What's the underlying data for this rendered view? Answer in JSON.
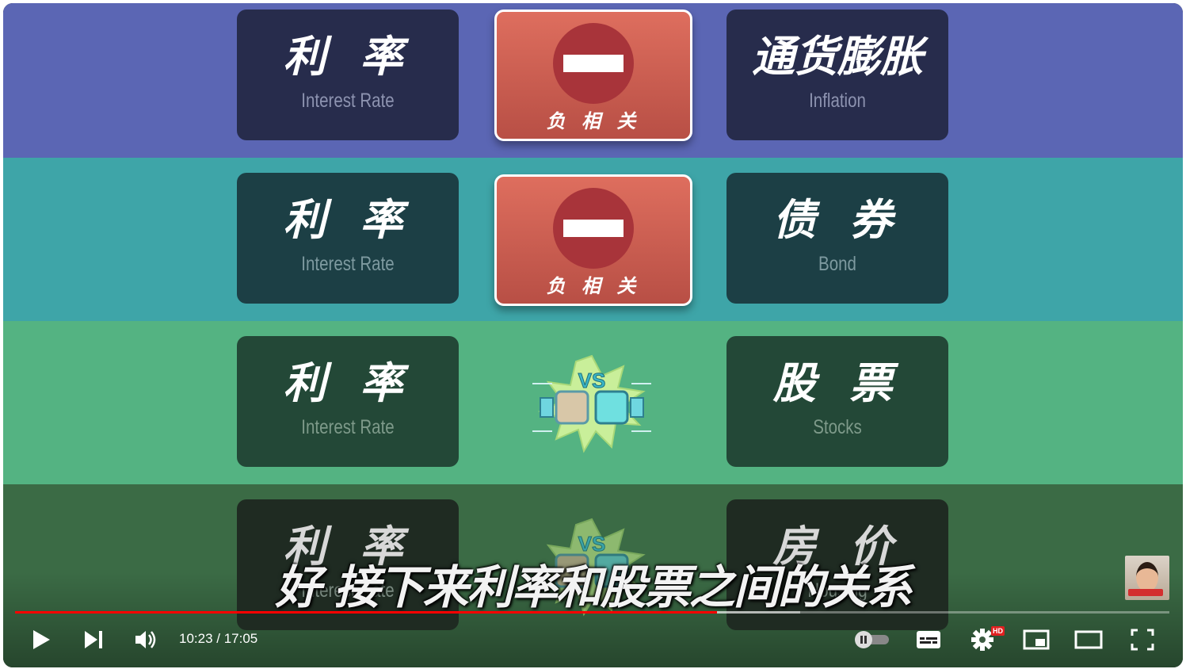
{
  "rows": [
    {
      "left": {
        "zh": "利 率",
        "en": "Interest Rate"
      },
      "middle": {
        "kind": "negative",
        "label": "负 相 关"
      },
      "right": {
        "zh": "通货膨胀",
        "en": "Inflation"
      }
    },
    {
      "left": {
        "zh": "利 率",
        "en": "Interest Rate"
      },
      "middle": {
        "kind": "negative",
        "label": "负 相 关"
      },
      "right": {
        "zh": "债 券",
        "en": "Bond"
      }
    },
    {
      "left": {
        "zh": "利 率",
        "en": "Interest Rate"
      },
      "middle": {
        "kind": "vs",
        "label": "VS"
      },
      "right": {
        "zh": "股 票",
        "en": "Stocks"
      }
    },
    {
      "left": {
        "zh": "利 率",
        "en": "Interest Rate"
      },
      "middle": {
        "kind": "vs",
        "label": "VS"
      },
      "right": {
        "zh": "房 价",
        "en": "Housing"
      }
    }
  ],
  "subtitle": "好 接下来利率和股票之间的关系",
  "player": {
    "time_display": "10:23 / 17:05",
    "current_time": "10:23",
    "duration": "17:05",
    "progress_fraction": 0.608,
    "buffered_fraction": 0.68,
    "hd_badge": "HD",
    "autoplay": "paused",
    "icons": {
      "play": "play-icon",
      "next": "skip-next-icon",
      "volume": "volume-icon",
      "autoplay": "autoplay-toggle-icon",
      "captions": "subtitles-icon",
      "settings": "settings-gear-icon",
      "miniplayer": "miniplayer-icon",
      "theater": "theater-mode-icon",
      "fullscreen": "fullscreen-icon"
    }
  },
  "colors": {
    "band1": "#5b66b4",
    "band2": "#3ea5a8",
    "band3": "#54b382",
    "band4": "#3b6b45",
    "progress_played": "#ff0000",
    "negative_card": "#c95a4e"
  }
}
